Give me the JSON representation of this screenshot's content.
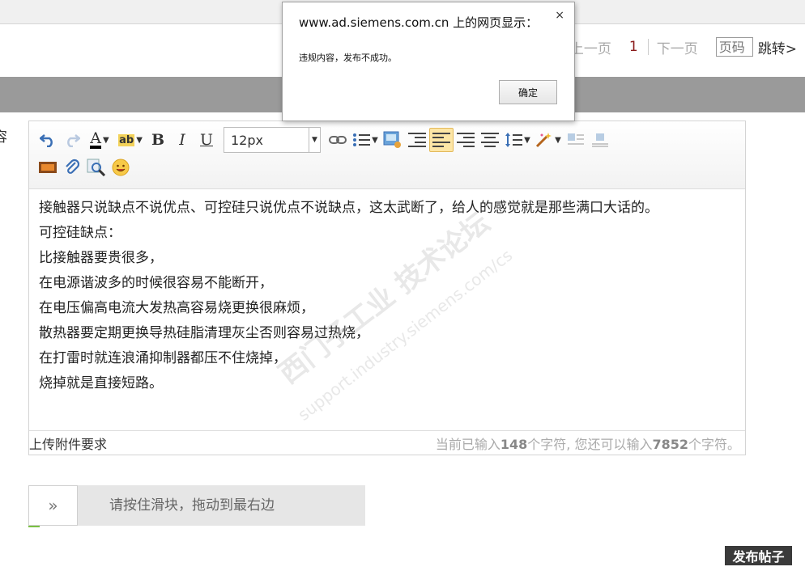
{
  "pagination": {
    "prev": "上一页",
    "current": "1",
    "next": "下一页",
    "page_placeholder": "页码",
    "jump": "跳转>"
  },
  "left_fragment": "容",
  "toolbar": {
    "font_size": "12px"
  },
  "editor": {
    "lines": [
      "接触器只说缺点不说优点、可控硅只说优点不说缺点，这太武断了，给人的感觉就是那些满口大话的。",
      "可控硅缺点：",
      "比接触器要贵很多，",
      "在电源谐波多的时候很容易不能断开，",
      "在电压偏高电流大发热高容易烧更换很麻烦，",
      "散热器要定期更换导热硅脂清理灰尘否则容易过热烧，",
      "在打雷时就连浪涌抑制器都压不住烧掉，",
      "烧掉就是直接短路。"
    ],
    "watermark_main": "西门子工业 技术论坛",
    "watermark_url": "support.industry.siemens.com/cs"
  },
  "footer": {
    "upload_label": "上传附件要求",
    "count_prefix": "当前已输入",
    "count_value": "148",
    "count_mid": "个字符, 您还可以输入",
    "remaining_value": "7852",
    "count_suffix": "个字符。"
  },
  "slider": {
    "handle_icon": "»",
    "hint": "请按住滑块，拖动到最右边"
  },
  "publish_label": "发布帖子",
  "dialog": {
    "title": "www.ad.siemens.com.cn 上的网页显示：",
    "message": "违规内容，发布不成功。",
    "ok_label": "确定",
    "close_icon": "×"
  }
}
